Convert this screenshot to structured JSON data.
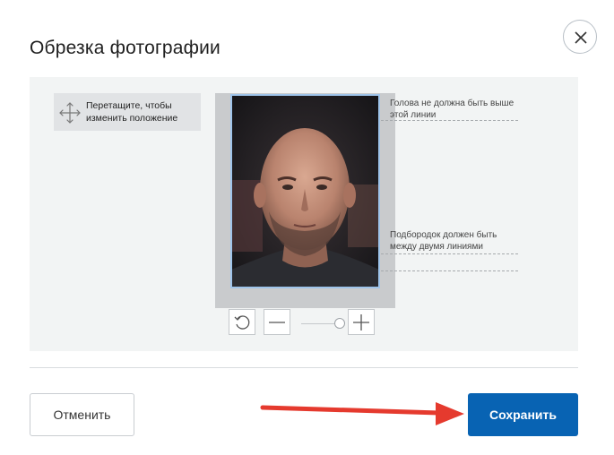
{
  "dialog": {
    "title": "Обрезка фотографии",
    "close_icon": "close-icon"
  },
  "crop": {
    "hint": "Перетащите, чтобы изменить положение",
    "hint_icon": "move-arrows-icon",
    "guide_top": "Голова не должна быть выше этой линии",
    "guide_chin": "Подбородок должен быть между двумя линиями",
    "controls": {
      "rotate_icon": "rotate-icon",
      "zoom_out_icon": "minus-icon",
      "zoom_in_icon": "plus-icon"
    }
  },
  "footer": {
    "cancel_label": "Отменить",
    "save_label": "Сохранить"
  },
  "colors": {
    "primary": "#0863b3",
    "annotation_arrow": "#e53a2e"
  }
}
